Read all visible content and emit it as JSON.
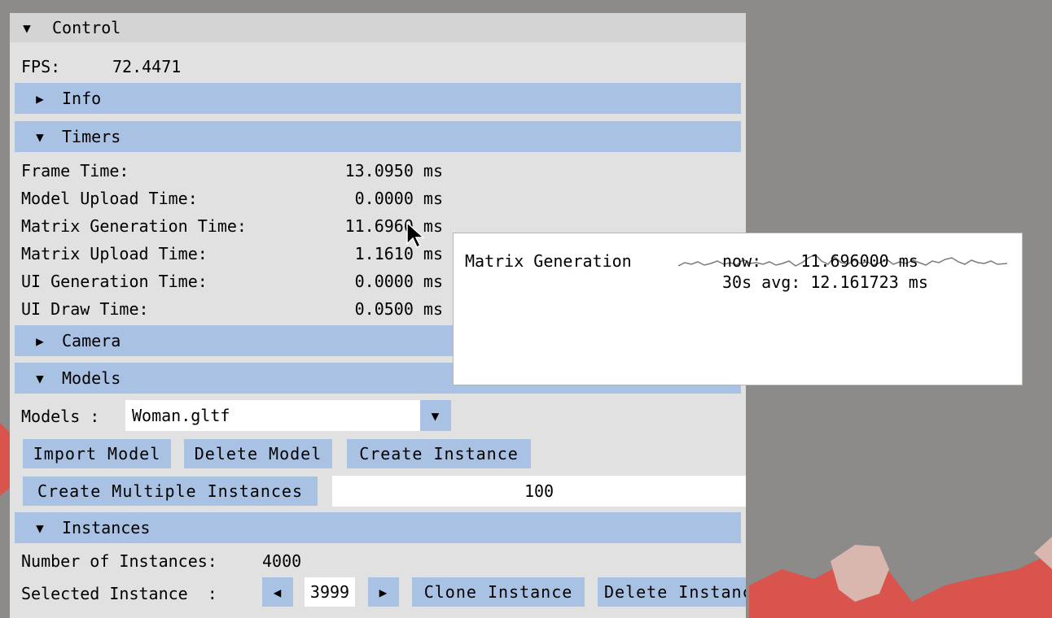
{
  "panel": {
    "title": "Control"
  },
  "fps": {
    "label": "FPS:",
    "value": "72.4471"
  },
  "sections": {
    "info": "Info",
    "timers": "Timers",
    "camera": "Camera",
    "models": "Models",
    "instances": "Instances"
  },
  "timers": [
    {
      "label": "Frame Time:",
      "value": "13.0950 ms"
    },
    {
      "label": "Model Upload Time:",
      "value": "0.0000 ms"
    },
    {
      "label": "Matrix Generation Time:",
      "value": "11.6960 ms"
    },
    {
      "label": "Matrix Upload Time:",
      "value": "1.1610 ms"
    },
    {
      "label": "UI Generation Time:",
      "value": "0.0000 ms"
    },
    {
      "label": "UI Draw Time:",
      "value": "0.0500 ms"
    }
  ],
  "models": {
    "label": "Models :",
    "selected": "Woman.gltf",
    "import_label": "Import Model",
    "delete_label": "Delete Model",
    "create_instance_label": "Create Instance",
    "create_multiple_label": "Create Multiple Instances",
    "multiple_count": "100"
  },
  "instances": {
    "count_label": "Number of Instances:",
    "count_value": "4000",
    "selected_label": "Selected Instance  :",
    "selected_value": "3999",
    "clone_label": "Clone Instance",
    "delete_label": "Delete Instance"
  },
  "tooltip": {
    "title": "Matrix Generation",
    "now_line": "now:    11.696000 ms",
    "avg_line": "30s avg: 12.161723 ms"
  },
  "colors": {
    "background": "#8c8b89",
    "panel": "#e1e1e1",
    "header": "#a9c2e3",
    "button": "#a9c2e3",
    "model_red": "#d8544c",
    "model_skin": "#d9b6ae"
  }
}
